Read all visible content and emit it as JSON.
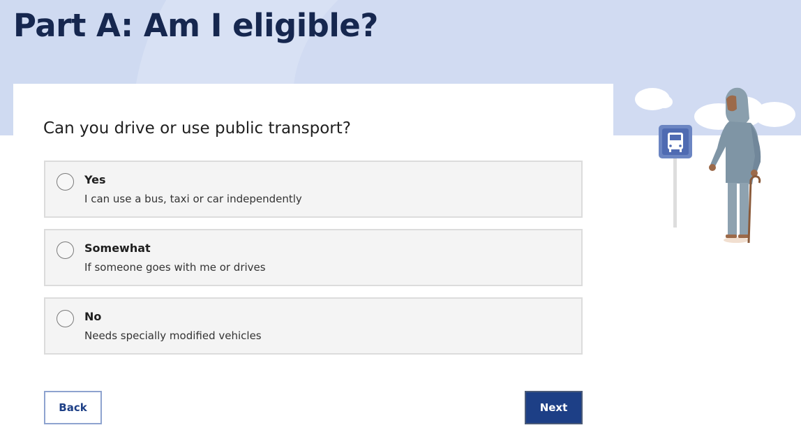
{
  "page": {
    "title": "Part A: Am I eligible?"
  },
  "question": {
    "text": "Can you drive or use public transport?",
    "options": [
      {
        "label": "Yes",
        "description": "I can use a bus, taxi or car independently",
        "selected": false
      },
      {
        "label": "Somewhat",
        "description": "If someone goes with me or drives",
        "selected": false
      },
      {
        "label": "No",
        "description": "Needs specially modified vehicles",
        "selected": false
      }
    ]
  },
  "actions": {
    "back_label": "Back",
    "next_label": "Next"
  },
  "illustration": {
    "icon": "bus-stop-illustration",
    "person": "person-with-cane-illustration"
  },
  "colors": {
    "hero_bg": "#cfdaf1",
    "title": "#16274f",
    "primary": "#1d3f86",
    "option_bg": "#f4f4f4"
  }
}
